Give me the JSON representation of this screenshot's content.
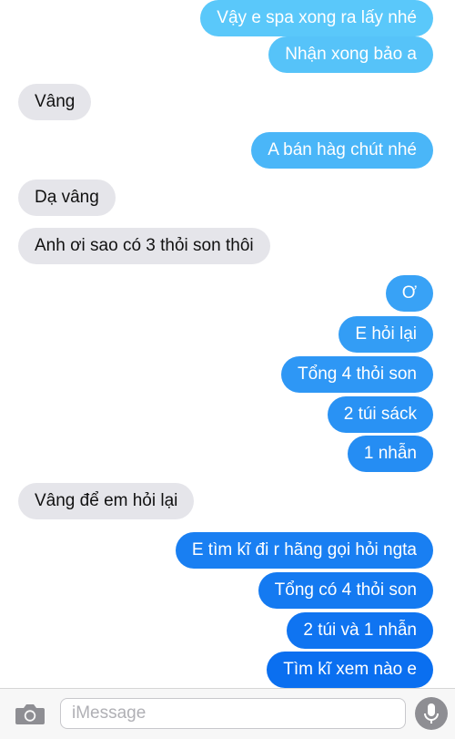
{
  "messages": [
    {
      "side": "out",
      "text": "Vậy e spa xong ra lấy nhé"
    },
    {
      "side": "out",
      "text": "Nhận xong bảo a"
    },
    {
      "side": "in",
      "text": "Vâng"
    },
    {
      "side": "out",
      "text": "A bán hàg chút nhé"
    },
    {
      "side": "in",
      "text": "Dạ vâng"
    },
    {
      "side": "in",
      "text": "Anh ơi sao có 3 thỏi son thôi"
    },
    {
      "side": "out",
      "text": "Ơ"
    },
    {
      "side": "out",
      "text": "E hỏi lại"
    },
    {
      "side": "out",
      "text": "Tổng 4 thỏi son"
    },
    {
      "side": "out",
      "text": "2 túi sáck"
    },
    {
      "side": "out",
      "text": "1 nhẫn"
    },
    {
      "side": "in",
      "text": "Vâng để em hỏi lại"
    },
    {
      "side": "out",
      "text": "E tìm kĩ đi r hãng gọi hỏi ngta"
    },
    {
      "side": "out",
      "text": "Tổng có 4 thỏi son"
    },
    {
      "side": "out",
      "text": "2 túi và 1 nhẫn"
    },
    {
      "side": "out",
      "text": "Tìm kĩ xem nào e"
    }
  ],
  "composer": {
    "placeholder": "iMessage",
    "camera_icon": "camera-icon",
    "mic_icon": "microphone-icon"
  },
  "colors": {
    "outgoing_top": "#5ac8fa",
    "outgoing_bottom": "#0a6ff0",
    "incoming": "#e5e5ea"
  }
}
